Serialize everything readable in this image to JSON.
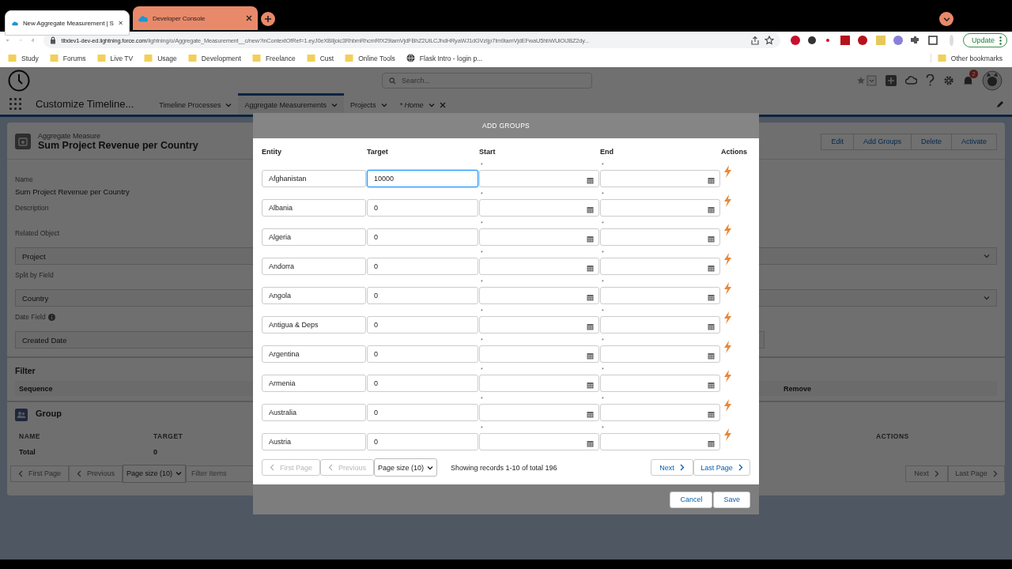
{
  "browser": {
    "tabs": [
      {
        "title": "New Aggregate Measurement | S",
        "selected": true,
        "color": "#ffffff"
      },
      {
        "title": "Developer Console",
        "selected": false,
        "color": "#e8896a"
      }
    ],
    "address": {
      "host": "tlbdev1-dev-ed.lightning.force.com",
      "path": "/lightning/o/Aggregate_Measurement__c/new?inContextOfRef=1.eyJ0eXBlIjoic3RhbmRhcmRfX29iamVjdFBhZ2UiLCJhdHRyaWJ1dGVzIjp7Im9iamVjdEFwaU5hbWUiOiJBZ2dy..."
    },
    "update_button": "Update",
    "bookmarks": [
      {
        "label": "Study",
        "kind": "folder"
      },
      {
        "label": "Forums",
        "kind": "folder"
      },
      {
        "label": "Live TV",
        "kind": "folder"
      },
      {
        "label": "Usage",
        "kind": "folder"
      },
      {
        "label": "Development",
        "kind": "folder"
      },
      {
        "label": "Freelance",
        "kind": "folder"
      },
      {
        "label": "Cust",
        "kind": "folder"
      },
      {
        "label": "Online Tools",
        "kind": "folder"
      },
      {
        "label": "Flask Intro - login p...",
        "kind": "site"
      }
    ],
    "other_bookmarks": "Other bookmarks"
  },
  "app": {
    "search_placeholder": "Search...",
    "notification_count": "2",
    "app_name": "Customize Timeline...",
    "nav_tabs": [
      {
        "label": "Timeline Processes",
        "selected": false,
        "italic": false,
        "closable": false
      },
      {
        "label": "Aggregate Measurements",
        "selected": true,
        "italic": false,
        "closable": false
      },
      {
        "label": "Projects",
        "selected": false,
        "italic": false,
        "closable": false
      },
      {
        "label": "* Home",
        "selected": false,
        "italic": true,
        "closable": true
      }
    ]
  },
  "record": {
    "object_label": "Aggregate Measure",
    "title": "Sum Project Revenue per Country",
    "actions": [
      "Edit",
      "Add Groups",
      "Delete",
      "Activate"
    ],
    "name_label": "Name",
    "name_value": "Sum Project Revenue per Country",
    "description_label": "Description",
    "related_object_label": "Related Object",
    "related_object_value": "Project",
    "split_label": "Split by Field",
    "split_value": "Country",
    "date_label": "Date Field",
    "date_value": "Created Date",
    "filter": {
      "title": "Filter",
      "columns": [
        "Sequence",
        "Remove"
      ]
    },
    "group": {
      "title": "Group",
      "columns": [
        "NAME",
        "TARGET",
        "ACTIONS"
      ],
      "total_label": "Total",
      "total_value": "0",
      "pager": {
        "first": {
          "label": "First Page",
          "disabled": true
        },
        "previous": {
          "label": "Previous",
          "disabled": true
        },
        "page_size": "Page size (10)",
        "filter_placeholder": "Filter Items",
        "next": {
          "label": "Next",
          "disabled": true
        },
        "last": {
          "label": "Last Page",
          "disabled": true
        }
      }
    }
  },
  "modal": {
    "title": "ADD GROUPS",
    "columns": [
      "Entity",
      "Target",
      "Start",
      "End",
      "Actions"
    ],
    "rows": [
      {
        "entity": "Afghanistan",
        "target": "10000",
        "focused": true,
        "start_mark": "*",
        "end_mark": "*"
      },
      {
        "entity": "Albania",
        "target": "0",
        "focused": false,
        "start_mark": "*",
        "end_mark": "*"
      },
      {
        "entity": "Algeria",
        "target": "0",
        "focused": false,
        "start_mark": "*",
        "end_mark": "*"
      },
      {
        "entity": "Andorra",
        "target": "0",
        "focused": false,
        "start_mark": "*",
        "end_mark": "*"
      },
      {
        "entity": "Angola",
        "target": "0",
        "focused": false,
        "start_mark": "*",
        "end_mark": "*"
      },
      {
        "entity": "Antigua & Deps",
        "target": "0",
        "focused": false,
        "start_mark": "*",
        "end_mark": "*"
      },
      {
        "entity": "Argentina",
        "target": "0",
        "focused": false,
        "start_mark": "*",
        "end_mark": "*"
      },
      {
        "entity": "Armenia",
        "target": "0",
        "focused": false,
        "start_mark": "*",
        "end_mark": "*"
      },
      {
        "entity": "Australia",
        "target": "0",
        "focused": false,
        "start_mark": "*",
        "end_mark": "*"
      },
      {
        "entity": "Austria",
        "target": "0",
        "focused": false,
        "start_mark": "*",
        "end_mark": "*"
      }
    ],
    "pager": {
      "first": {
        "label": "First Page",
        "disabled": true
      },
      "previous": {
        "label": "Previous",
        "disabled": true
      },
      "page_size": "Page size (10)",
      "status": "Showing records 1-10 of total 196",
      "next": {
        "label": "Next",
        "disabled": false
      },
      "last": {
        "label": "Last Page",
        "disabled": false
      }
    },
    "footer_buttons": [
      "Cancel",
      "Save"
    ]
  }
}
